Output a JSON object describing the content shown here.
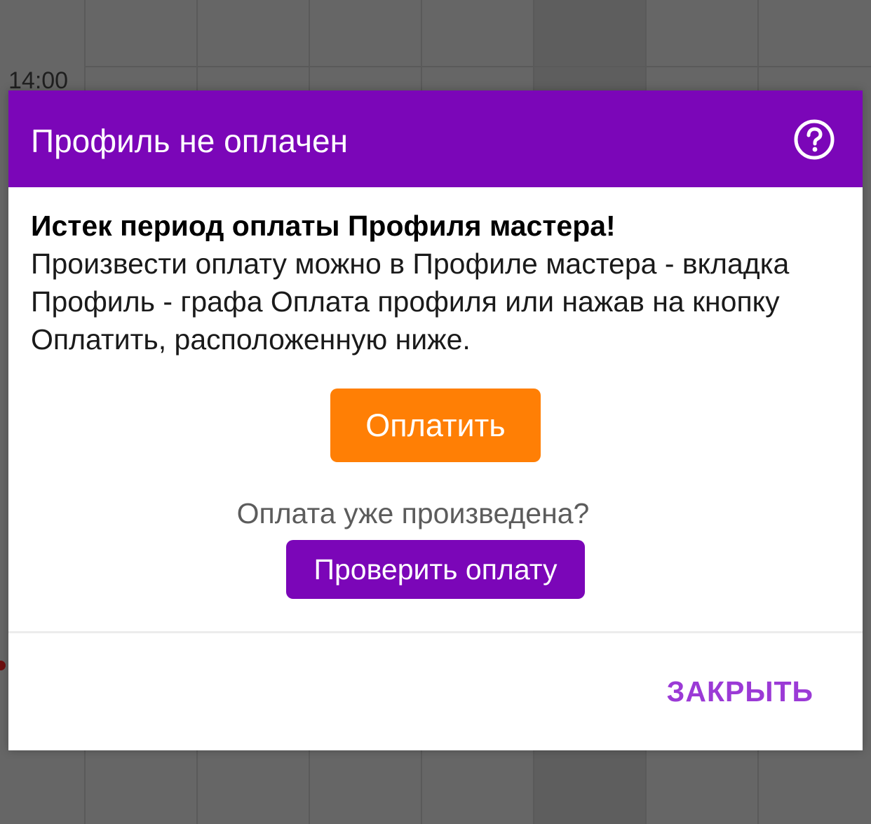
{
  "calendar": {
    "time_label": "14:00"
  },
  "dialog": {
    "title": "Профиль не оплачен",
    "help_icon": "question-circle-icon",
    "message_bold": "Истек период оплаты Профиля мастера!",
    "message_text": "Произвести оплату можно в Профиле мастера - вкладка Профиль - графа Оплата профиля или нажав на кнопку Оплатить, расположенную ниже.",
    "pay_button_label": "Оплатить",
    "already_paid_text": "Оплата уже произведена?",
    "check_button_label": "Проверить оплату",
    "close_button_label": "ЗАКРЫТЬ"
  },
  "colors": {
    "header": "#7b06b8",
    "pay_button": "#ff7f05",
    "check_button": "#7b06b8",
    "close_text": "#9b3ad6",
    "overlay_background": "#666666"
  }
}
